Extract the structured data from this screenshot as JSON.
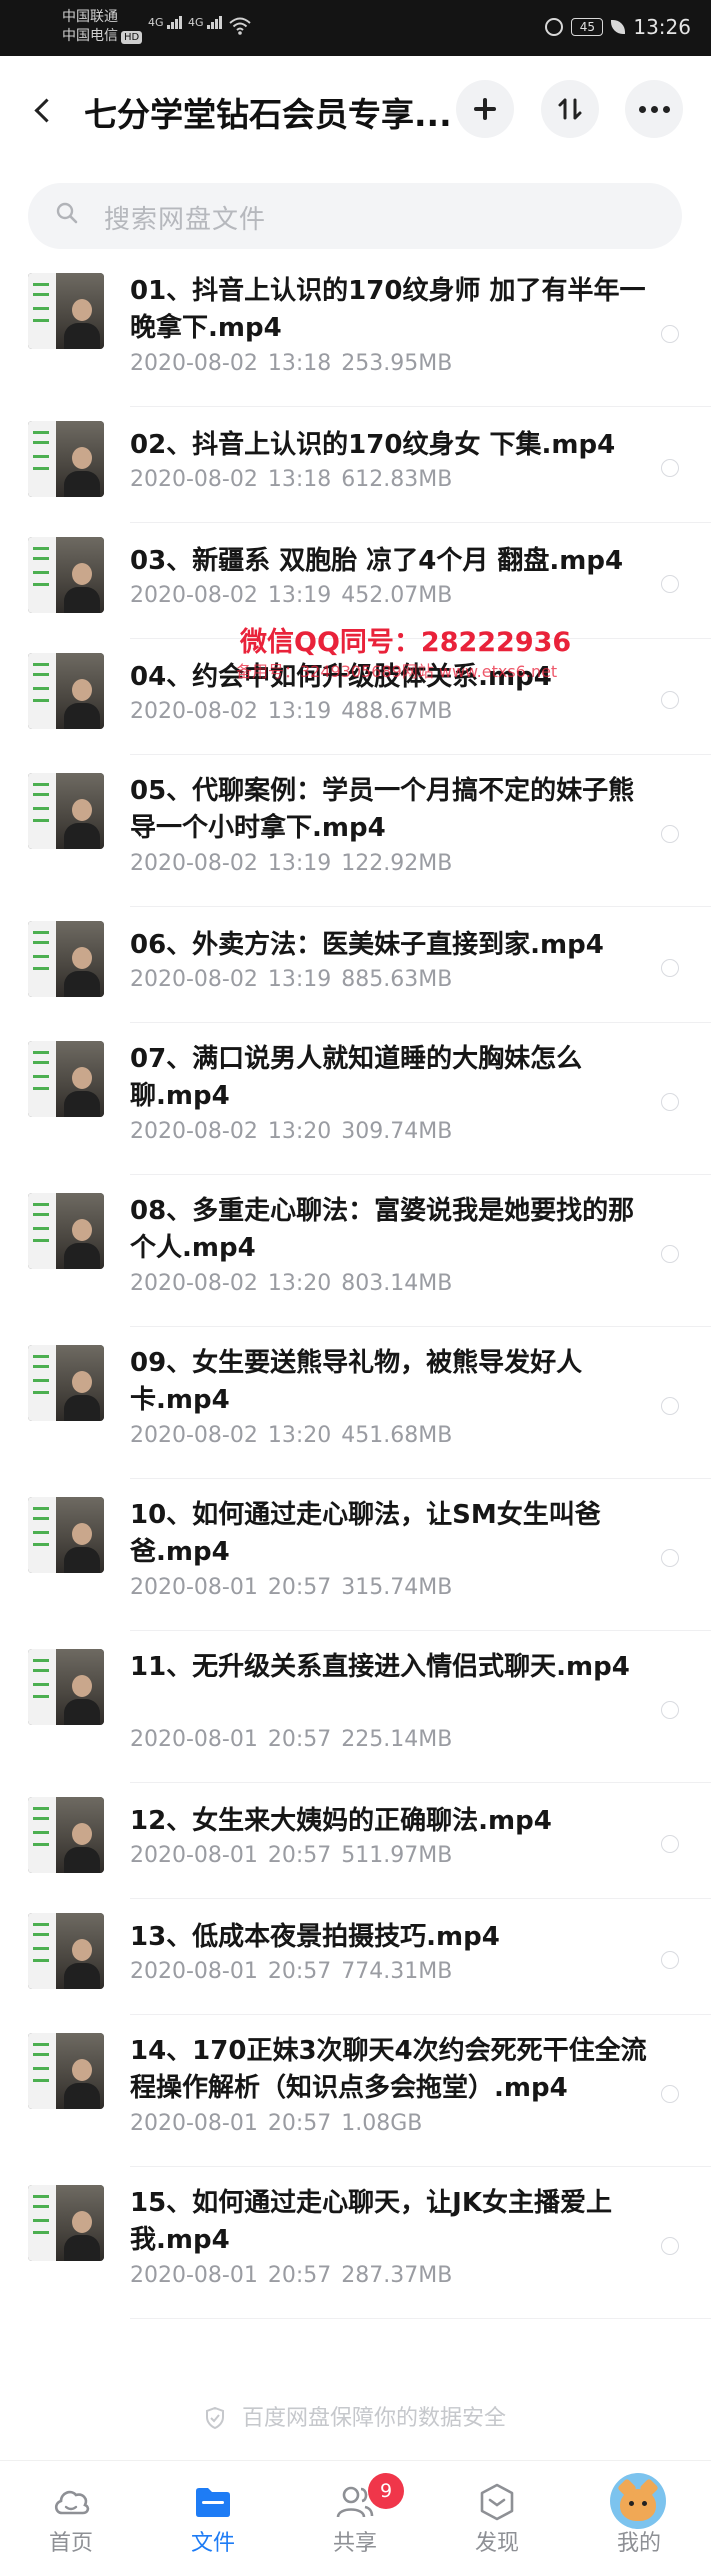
{
  "status_bar": {
    "carrier1": "中国联通",
    "carrier2": "中国电信",
    "hd": "HD",
    "sig1": "4G",
    "sig2": "4G",
    "battery": "45",
    "time": "13:26"
  },
  "header": {
    "title": "七分学堂钻石会员专享..."
  },
  "search": {
    "placeholder": "搜索网盘文件"
  },
  "watermark": {
    "line1": "微信QQ同号：28222936",
    "line2": "备用号：3249305689网站 www.etxs6.net"
  },
  "files": [
    {
      "name": "01、抖音上认识的170纹身师 加了有半年一晚拿下.mp4",
      "date": "2020-08-02",
      "time": "13:18",
      "size": "253.95MB"
    },
    {
      "name": "02、抖音上认识的170纹身女 下集.mp4",
      "date": "2020-08-02",
      "time": "13:18",
      "size": "612.83MB"
    },
    {
      "name": "03、新疆系 双胞胎 凉了4个月 翻盘.mp4",
      "date": "2020-08-02",
      "time": "13:19",
      "size": "452.07MB"
    },
    {
      "name": "04、约会中如何升级肢体关系.mp4",
      "date": "2020-08-02",
      "time": "13:19",
      "size": "488.67MB"
    },
    {
      "name": "05、代聊案例：学员一个月搞不定的妹子熊导一个小时拿下.mp4",
      "date": "2020-08-02",
      "time": "13:19",
      "size": "122.92MB"
    },
    {
      "name": "06、外卖方法：医美妹子直接到家.mp4",
      "date": "2020-08-02",
      "time": "13:19",
      "size": "885.63MB"
    },
    {
      "name": "07、满口说男人就知道睡的大胸妹怎么聊.mp4",
      "date": "2020-08-02",
      "time": "13:20",
      "size": "309.74MB"
    },
    {
      "name": "08、多重走心聊法：富婆说我是她要找的那个人.mp4",
      "date": "2020-08-02",
      "time": "13:20",
      "size": "803.14MB"
    },
    {
      "name": "09、女生要送熊导礼物，被熊导发好人卡.mp4",
      "date": "2020-08-02",
      "time": "13:20",
      "size": "451.68MB"
    },
    {
      "name": "10、如何通过走心聊法，让SM女生叫爸爸.mp4",
      "date": "2020-08-01",
      "time": "20:57",
      "size": "315.74MB"
    },
    {
      "name": "11、无升级关系直接进入情侣式聊天.mp4",
      "date": "2020-08-01",
      "time": "20:57",
      "size": "225.14MB"
    },
    {
      "name": "12、女生来大姨妈的正确聊法.mp4",
      "date": "2020-08-01",
      "time": "20:57",
      "size": "511.97MB"
    },
    {
      "name": "13、低成本夜景拍摄技巧.mp4",
      "date": "2020-08-01",
      "time": "20:57",
      "size": "774.31MB"
    },
    {
      "name": "14、170正妹3次聊天4次约会死死干住全流程操作解析（知识点多会拖堂）.mp4",
      "date": "2020-08-01",
      "time": "20:57",
      "size": "1.08GB"
    },
    {
      "name": "15、如何通过走心聊天，让JK女主播爱上我.mp4",
      "date": "2020-08-01",
      "time": "20:57",
      "size": "287.37MB"
    }
  ],
  "security_note": "百度网盘保障你的数据安全",
  "nav": {
    "home": "首页",
    "files": "文件",
    "share": "共享",
    "share_badge": "9",
    "discover": "发现",
    "mine": "我的"
  },
  "colors": {
    "accent": "#1e7cf5",
    "badge": "#f0364a",
    "watermark": "#e9223a"
  }
}
